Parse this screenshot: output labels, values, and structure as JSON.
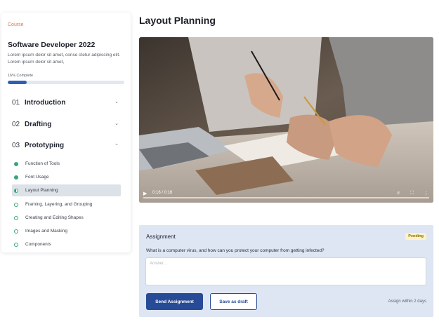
{
  "sidebar": {
    "breadcrumb": "Course",
    "course_title": "Software Developer 2022",
    "course_description": "Lorem ipsum dolor sit amet, conse ctetur adipiscing elit. Lorem ipsum dolor sit amet,",
    "progress_label": "16% Complete",
    "progress_fraction": 0.16,
    "sections": [
      {
        "number": "01",
        "name": "Introduction",
        "expanded": false,
        "icon": "chevron-down-icon"
      },
      {
        "number": "02",
        "name": "Drafting",
        "expanded": false,
        "icon": "chevron-down-icon"
      },
      {
        "number": "03",
        "name": "Prototyping",
        "expanded": true,
        "icon": "chevron-up-icon"
      }
    ],
    "lessons": [
      {
        "label": "Function of Tools",
        "status": "done"
      },
      {
        "label": "Font Usage",
        "status": "done"
      },
      {
        "label": "Layout Planning",
        "status": "in-progress",
        "active": true
      },
      {
        "label": "Framing, Layering, and Grouping",
        "status": "todo"
      },
      {
        "label": "Creating and Editing Shapes",
        "status": "todo"
      },
      {
        "label": "Images and Masking",
        "status": "todo"
      },
      {
        "label": "Components",
        "status": "todo"
      }
    ]
  },
  "main": {
    "title": "Layout Planning",
    "video": {
      "time": "0:16 / 0:16",
      "progress_fraction": 1.0,
      "icons": [
        "play-icon",
        "mute-icon",
        "fullscreen-icon",
        "more-icon"
      ]
    },
    "assignment": {
      "title": "Assignment",
      "status": "Pending",
      "question": "What is a computer virus, and how can you protect your computer from getting infected?",
      "answer_placeholder": "Answer...",
      "answer_value": "",
      "send_label": "Send Assignment",
      "draft_label": "Save as draft",
      "due_note": "Assign within 2 days"
    }
  },
  "colors": {
    "accent": "#274b96",
    "progress": "#2f5fb4",
    "breadcrumb": "#e8743b",
    "complete": "#3aa47a",
    "pending_badge_bg": "#fdf3c4",
    "assignment_bg": "#dee5f3"
  }
}
